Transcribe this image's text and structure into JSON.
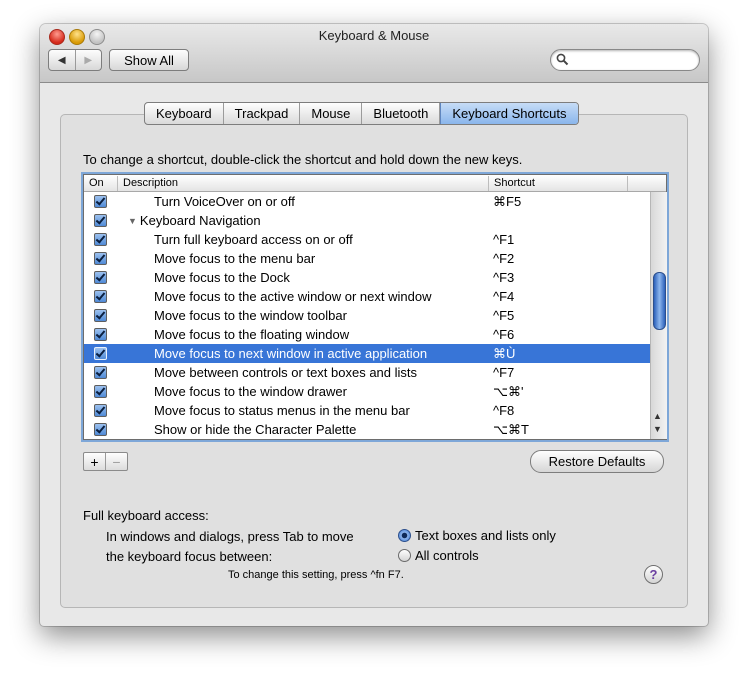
{
  "window": {
    "title": "Keyboard & Mouse",
    "show_all_label": "Show All",
    "nav": {
      "back_glyph": "◀",
      "forward_glyph": "▶"
    },
    "search": {
      "placeholder": "",
      "icon": "search-icon"
    }
  },
  "tabs": [
    {
      "label": "Keyboard",
      "active": false
    },
    {
      "label": "Trackpad",
      "active": false
    },
    {
      "label": "Mouse",
      "active": false
    },
    {
      "label": "Bluetooth",
      "active": false
    },
    {
      "label": "Keyboard Shortcuts",
      "active": true
    }
  ],
  "instructions": "To change a shortcut, double-click the shortcut and hold down the new keys.",
  "table": {
    "columns": {
      "on": "On",
      "description": "Description",
      "shortcut": "Shortcut"
    },
    "rows": [
      {
        "on": true,
        "description": "Turn VoiceOver on or off",
        "shortcut": "⌘F5",
        "group": false,
        "selected": false
      },
      {
        "on": true,
        "description": "Keyboard Navigation",
        "shortcut": "",
        "group": true,
        "selected": false
      },
      {
        "on": true,
        "description": "Turn full keyboard access on or off",
        "shortcut": "^F1",
        "group": false,
        "selected": false
      },
      {
        "on": true,
        "description": "Move focus to the menu bar",
        "shortcut": "^F2",
        "group": false,
        "selected": false
      },
      {
        "on": true,
        "description": "Move focus to the Dock",
        "shortcut": "^F3",
        "group": false,
        "selected": false
      },
      {
        "on": true,
        "description": "Move focus to the active window or next window",
        "shortcut": "^F4",
        "group": false,
        "selected": false
      },
      {
        "on": true,
        "description": "Move focus to the window toolbar",
        "shortcut": "^F5",
        "group": false,
        "selected": false
      },
      {
        "on": true,
        "description": "Move focus to the floating window",
        "shortcut": "^F6",
        "group": false,
        "selected": false
      },
      {
        "on": true,
        "description": "Move focus to next window in active application",
        "shortcut": "⌘Ù",
        "group": false,
        "selected": true
      },
      {
        "on": true,
        "description": "Move between controls or text boxes and lists",
        "shortcut": "^F7",
        "group": false,
        "selected": false
      },
      {
        "on": true,
        "description": "Move focus to the window drawer",
        "shortcut": "⌥⌘'",
        "group": false,
        "selected": false
      },
      {
        "on": true,
        "description": "Move focus to status menus in the menu bar",
        "shortcut": "^F8",
        "group": false,
        "selected": false
      },
      {
        "on": true,
        "description": "Show or hide the Character Palette",
        "shortcut": "⌥⌘T",
        "group": false,
        "selected": false
      }
    ]
  },
  "buttons": {
    "add": "+",
    "remove": "−",
    "restore_defaults": "Restore Defaults"
  },
  "full_keyboard_access": {
    "label": "Full keyboard access:",
    "description_line1": "In windows and dialogs, press Tab to move",
    "description_line2": "the keyboard focus between:",
    "options": [
      {
        "label": "Text boxes and lists only",
        "selected": true
      },
      {
        "label": "All controls",
        "selected": false
      }
    ],
    "hint": "To change this setting, press ^fn F7."
  },
  "help_label": "?",
  "colors": {
    "selection": "#3875d7",
    "accent": "#8ab6ec",
    "help_question": "#6b3fa0"
  }
}
